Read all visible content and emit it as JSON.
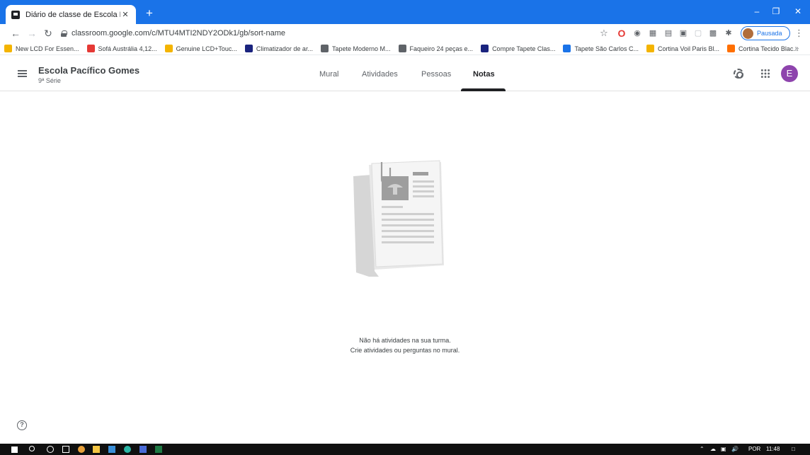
{
  "browser": {
    "tab_title": "Diário de classe de Escola Pacífic",
    "tab_close": "✕",
    "new_tab": "+",
    "url": "classroom.google.com/c/MTU4MTI2NDY2ODk1/gb/sort-name",
    "profile_status": "Pausada",
    "bookmarks": [
      {
        "label": "New LCD For Essen...",
        "color": "#f4b400"
      },
      {
        "label": "Sofá Austrália 4,12...",
        "color": "#e53935"
      },
      {
        "label": "Genuine LCD+Touc...",
        "color": "#f4b400"
      },
      {
        "label": "Climatizador de ar...",
        "color": "#1a237e"
      },
      {
        "label": "Tapete Moderno M...",
        "color": "#5f6368"
      },
      {
        "label": "Faqueiro 24 peças e...",
        "color": "#5f6368"
      },
      {
        "label": "Compre Tapete Clas...",
        "color": "#1a237e"
      },
      {
        "label": "Tapete São Carlos C...",
        "color": "#1a73e8"
      },
      {
        "label": "Cortina Voil Paris Bl...",
        "color": "#f4b400"
      },
      {
        "label": "Cortina Tecido Blac...",
        "color": "#ff6f00"
      }
    ],
    "bookmarks_more": "»",
    "accent": "#1a73e8"
  },
  "classroom": {
    "class_name": "Escola Pacífico Gomes",
    "class_section": "9ª Série",
    "tabs": [
      "Mural",
      "Atividades",
      "Pessoas",
      "Notas"
    ],
    "active_tab": "Notas",
    "avatar_letter": "E",
    "avatar_color": "#8e44ad"
  },
  "empty_state": {
    "line1": "Não há atividades na sua turma.",
    "line2": "Crie atividades ou perguntas no mural."
  },
  "help_icon_label": "?",
  "taskbar": {
    "language": "POR",
    "time": "11:48"
  }
}
